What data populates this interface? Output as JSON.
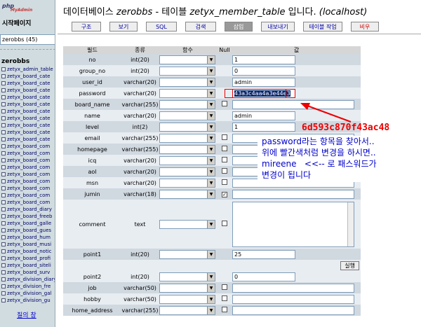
{
  "nav": {
    "logo_main": "php",
    "logo_sub": "MyAdmin",
    "home": "시작페이지",
    "db_select": "zerobbs (45)",
    "db_name": "zerobbs",
    "tables": [
      "zetyx_admin_table",
      "zetyx_board_cate",
      "zetyx_board_cate",
      "zetyx_board_cate",
      "zetyx_board_cate",
      "zetyx_board_cate",
      "zetyx_board_cate",
      "zetyx_board_cate",
      "zetyx_board_cate",
      "zetyx_board_cate",
      "zetyx_board_cate",
      "zetyx_board_com",
      "zetyx_board_com",
      "zetyx_board_com",
      "zetyx_board_com",
      "zetyx_board_com",
      "zetyx_board_com",
      "zetyx_board_com",
      "zetyx_board_com",
      "zetyx_board_com",
      "zetyx_board_diary",
      "zetyx_board_freeb",
      "zetyx_board_galle",
      "zetyx_board_gues",
      "zetyx_board_hum",
      "zetyx_board_musi",
      "zetyx_board_notic",
      "zetyx_board_profi",
      "zetyx_board_siteli",
      "zetyx_board_surv",
      "zetyx_division_diary",
      "zetyx_division_fre",
      "zetyx_division_gal",
      "zetyx_division_gu"
    ],
    "query_window": "질의 창"
  },
  "title": {
    "prefix": "데이터베이스",
    "db": "zerobbs",
    "mid": "- 테이블",
    "table": "zetyx_member_table",
    "suffix": "입니다.",
    "host": "(localhost)"
  },
  "tabs": [
    {
      "label": "구조",
      "active": false
    },
    {
      "label": "보기",
      "active": false
    },
    {
      "label": "SQL",
      "active": false
    },
    {
      "label": "검색",
      "active": false
    },
    {
      "label": "삽입",
      "active": true
    },
    {
      "label": "내보내기",
      "active": false
    },
    {
      "label": "테이블 작업",
      "active": false
    },
    {
      "label": "비우",
      "active": false
    }
  ],
  "headers": {
    "field": "필드",
    "type": "종류",
    "func": "함수",
    "null": "Null",
    "value": "값"
  },
  "rows": [
    {
      "field": "no",
      "type": "int(20)",
      "value": "1"
    },
    {
      "field": "group_no",
      "type": "int(20)",
      "value": "0"
    },
    {
      "field": "user_id",
      "type": "varchar(20)",
      "value": "admin"
    },
    {
      "field": "password",
      "type": "varchar(20)",
      "value": "43a3c4aa4a3e44e3"
    },
    {
      "field": "board_name",
      "type": "varchar(255)",
      "value": ""
    },
    {
      "field": "name",
      "type": "varchar(20)",
      "value": "admin"
    },
    {
      "field": "level",
      "type": "int(2)",
      "value": "1"
    },
    {
      "field": "email",
      "type": "varchar(255)",
      "value": ""
    },
    {
      "field": "homepage",
      "type": "varchar(255)",
      "value": ""
    },
    {
      "field": "icq",
      "type": "varchar(20)",
      "value": ""
    },
    {
      "field": "aol",
      "type": "varchar(20)",
      "value": ""
    },
    {
      "field": "msn",
      "type": "varchar(20)",
      "value": ""
    },
    {
      "field": "jumin",
      "type": "varchar(18)",
      "value": ""
    },
    {
      "field": "comment",
      "type": "text",
      "value": ""
    },
    {
      "field": "point1",
      "type": "int(20)",
      "value": "25"
    }
  ],
  "run_button": "실행",
  "rows2": [
    {
      "field": "point2",
      "type": "int(20)",
      "value": "0"
    },
    {
      "field": "job",
      "type": "varchar(50)",
      "value": ""
    },
    {
      "field": "hobby",
      "type": "varchar(50)",
      "value": ""
    },
    {
      "field": "home_address",
      "type": "varchar(255)",
      "value": ""
    }
  ],
  "annotation": {
    "hash": "6d593c870f43ac48",
    "note_lines": [
      "password라는 항목을 찾아서..",
      "위에 빨간색처럼 변경을 하시면..",
      "mireene   <<-- 로 패스워드가",
      "변경이 됩니다"
    ],
    "bottom_cut": "...",
    "color": "#ee0000"
  }
}
